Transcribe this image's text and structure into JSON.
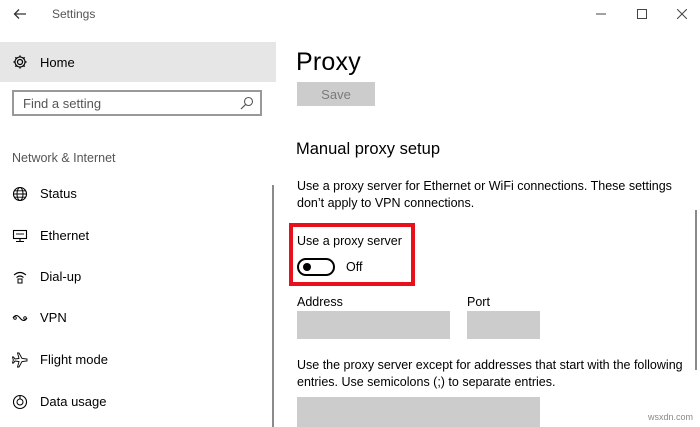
{
  "window": {
    "title": "Settings"
  },
  "sidebar": {
    "home_label": "Home",
    "search_placeholder": "Find a setting",
    "section_label": "Network & Internet",
    "items": [
      {
        "label": "Status",
        "icon": "globe-icon"
      },
      {
        "label": "Ethernet",
        "icon": "ethernet-icon"
      },
      {
        "label": "Dial-up",
        "icon": "dialup-icon"
      },
      {
        "label": "VPN",
        "icon": "vpn-icon"
      },
      {
        "label": "Flight mode",
        "icon": "airplane-icon"
      },
      {
        "label": "Data usage",
        "icon": "data-usage-icon"
      }
    ]
  },
  "main": {
    "title": "Proxy",
    "save_label": "Save",
    "manual_heading": "Manual proxy setup",
    "manual_description": "Use a proxy server for Ethernet or WiFi connections. These settings don’t apply to VPN connections.",
    "use_proxy_label": "Use a proxy server",
    "use_proxy_state": "Off",
    "use_proxy_on": false,
    "address_label": "Address",
    "address_value": "",
    "port_label": "Port",
    "port_value": "",
    "exceptions_description": "Use the proxy server except for addresses that start with the following entries. Use semicolons (;) to separate entries.",
    "exceptions_value": ""
  },
  "watermark": "wsxdn.com",
  "colors": {
    "highlight_box": "#e8101a",
    "selected_nav_bg": "#e6e6e6",
    "disabled_button_bg": "#cccccc",
    "field_bg": "#cccccc"
  }
}
